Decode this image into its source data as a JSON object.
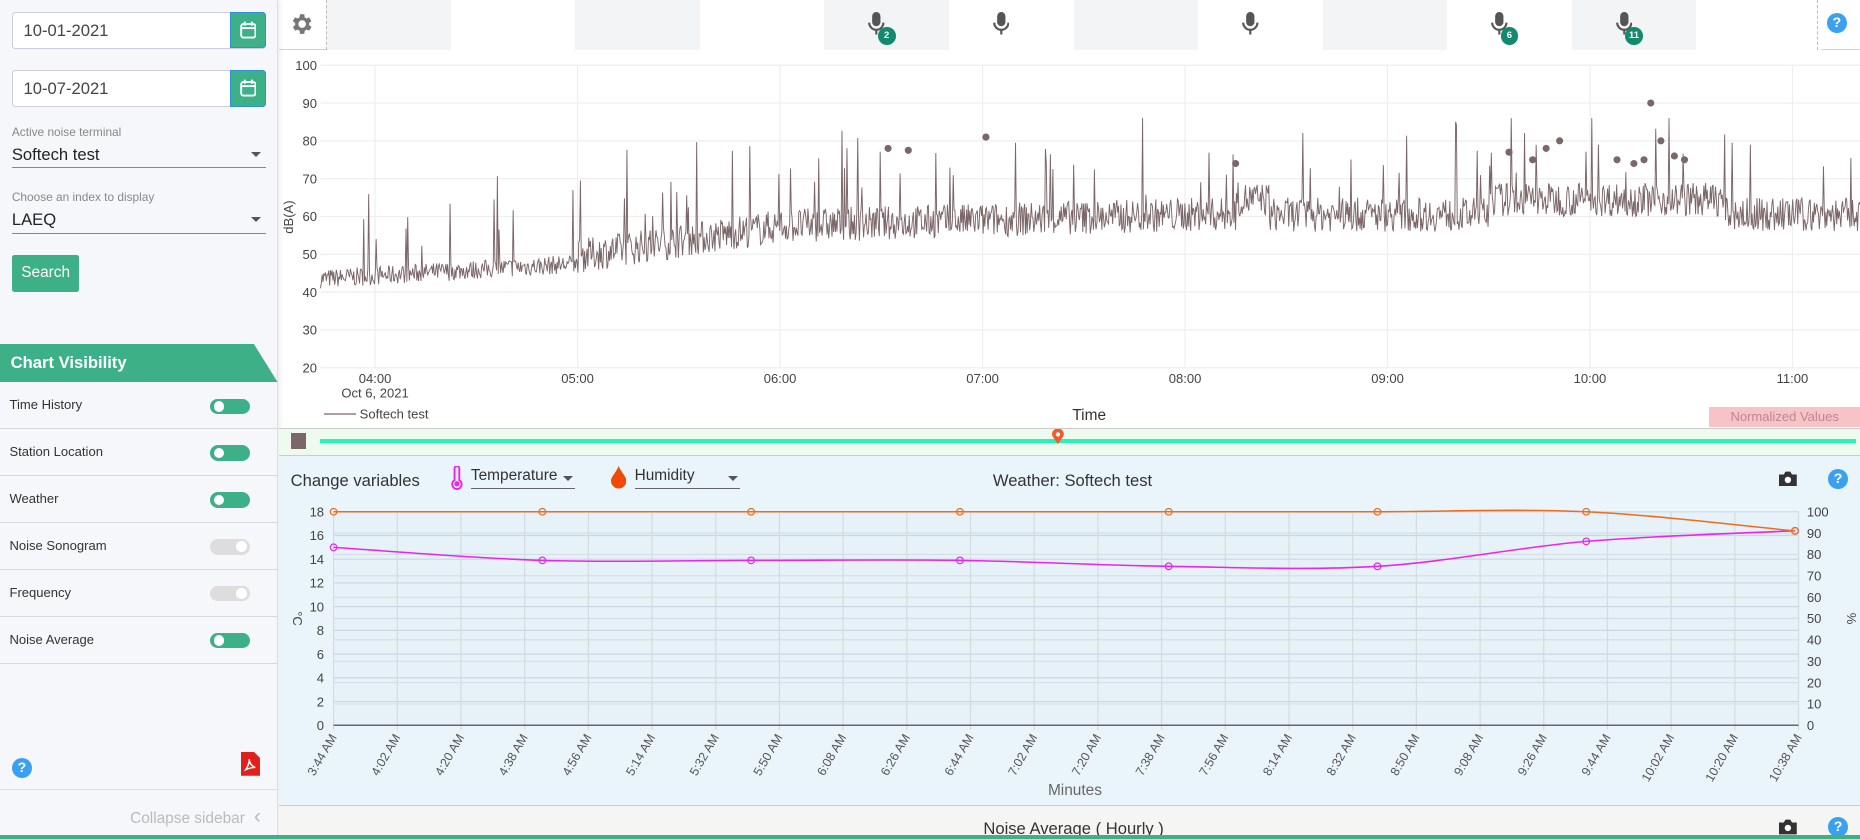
{
  "sidebar": {
    "start_date": "10-01-2021",
    "end_date": "10-07-2021",
    "terminal_label": "Active noise terminal",
    "terminal_value": "Softech test",
    "index_label": "Choose an index to display",
    "index_value": "LAEQ",
    "search_label": "Search",
    "visibility_title": "Chart Visibility",
    "visibility_items": [
      {
        "label": "Time History",
        "on": true
      },
      {
        "label": "Station Location",
        "on": true
      },
      {
        "label": "Weather",
        "on": true
      },
      {
        "label": "Noise Sonogram",
        "on": false
      },
      {
        "label": "Frequency",
        "on": false
      },
      {
        "label": "Noise Average",
        "on": true
      }
    ],
    "help_icon": "help-icon",
    "pdf_icon": "pdf-icon",
    "collapse_label": "Collapse sidebar"
  },
  "toolbar": {
    "mic_badges": [
      "2",
      "",
      "",
      "6",
      "11"
    ],
    "help": "?"
  },
  "noise_chart": {
    "y_label": "dB(A)",
    "y_ticks": [
      "100",
      "90",
      "80",
      "70",
      "60",
      "50",
      "40",
      "30",
      "20"
    ],
    "x_ticks": [
      "04:00",
      "05:00",
      "06:00",
      "07:00",
      "08:00",
      "09:00",
      "10:00",
      "11:00"
    ],
    "x_date": "Oct 6, 2021",
    "x_label": "Time",
    "legend": "Softech test",
    "normalized_label": "Normalized Values",
    "line_color": "#7b6669",
    "peak_markers": [
      {
        "time": "06:32",
        "db": 78
      },
      {
        "time": "06:38",
        "db": 77.5
      },
      {
        "time": "07:01",
        "db": 81
      },
      {
        "time": "08:15",
        "db": 74
      },
      {
        "time": "09:36",
        "db": 77
      },
      {
        "time": "09:43",
        "db": 75
      },
      {
        "time": "09:47",
        "db": 78
      },
      {
        "time": "09:51",
        "db": 80
      },
      {
        "time": "10:08",
        "db": 75
      },
      {
        "time": "10:13",
        "db": 74
      },
      {
        "time": "10:16",
        "db": 75
      },
      {
        "time": "10:18",
        "db": 90
      },
      {
        "time": "10:21",
        "db": 80
      },
      {
        "time": "10:25",
        "db": 76
      },
      {
        "time": "10:28",
        "db": 75
      }
    ]
  },
  "weather": {
    "change_label": "Change variables",
    "var1": "Temperature",
    "var2": "Humidity",
    "title": "Weather: Softech test",
    "help": "?",
    "left_unit": "°C",
    "right_unit": "%",
    "x_label": "Minutes",
    "left_ticks": [
      "0",
      "2",
      "4",
      "6",
      "8",
      "10",
      "12",
      "14",
      "16",
      "18"
    ],
    "right_ticks": [
      "0",
      "10",
      "20",
      "30",
      "40",
      "50",
      "60",
      "70",
      "80",
      "90",
      "100"
    ],
    "x_ticks": [
      "3:44 AM",
      "4:02 AM",
      "4:20 AM",
      "4:38 AM",
      "4:56 AM",
      "5:14 AM",
      "5:32 AM",
      "5:50 AM",
      "6:08 AM",
      "6:26 AM",
      "6:44 AM",
      "7:02 AM",
      "7:20 AM",
      "7:38 AM",
      "7:56 AM",
      "8:14 AM",
      "8:32 AM",
      "8:50 AM",
      "9:08 AM",
      "9:26 AM",
      "9:44 AM",
      "10:02 AM",
      "10:20 AM",
      "10:38 AM"
    ]
  },
  "chart_data": {
    "type": "line",
    "title": "Weather: Softech test",
    "xlabel": "Minutes",
    "ylabel": "°C",
    "y2label": "%",
    "ylim": [
      0,
      18
    ],
    "y2lim": [
      0,
      100
    ],
    "x": [
      "3:44 AM",
      "4:43 AM",
      "5:42 AM",
      "6:41 AM",
      "7:40 AM",
      "8:39 AM",
      "9:38 AM",
      "10:37 AM"
    ],
    "series": [
      {
        "name": "Temperature",
        "axis": "left",
        "color": "#ee22ee",
        "values": [
          15,
          13.9,
          13.9,
          13.9,
          13.4,
          13.4,
          15.5,
          16.4
        ]
      },
      {
        "name": "Humidity",
        "axis": "right",
        "color": "#f26a1b",
        "values": [
          100,
          100,
          100,
          100,
          100,
          100,
          100,
          91
        ]
      }
    ]
  },
  "noise_average": {
    "title": "Noise Average ( Hourly )",
    "help": "?"
  }
}
